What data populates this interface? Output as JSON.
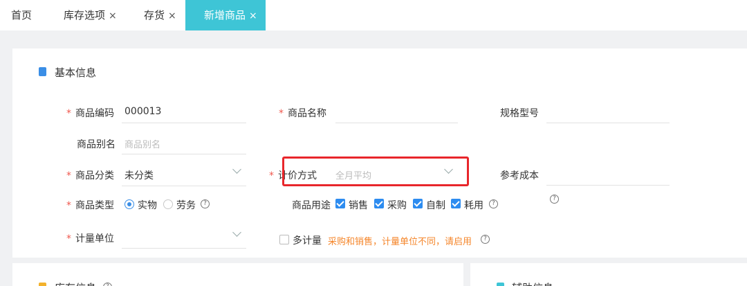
{
  "tabs": [
    {
      "label": "首页",
      "close": ""
    },
    {
      "label": "库存选项",
      "close": "×"
    },
    {
      "label": "存货",
      "close": "×"
    },
    {
      "label": "新增商品",
      "close": "×"
    }
  ],
  "basic": {
    "title": "基本信息",
    "required_mark": "*",
    "code": {
      "label": "商品编码",
      "value": "000013"
    },
    "name": {
      "label": "商品名称",
      "value": ""
    },
    "spec": {
      "label": "规格型号",
      "value": ""
    },
    "alias": {
      "label": "商品别名",
      "placeholder": "商品别名"
    },
    "category": {
      "label": "商品分类",
      "value": "未分类"
    },
    "pricing": {
      "label": "计价方式",
      "placeholder": "全月平均"
    },
    "ref_cost": {
      "label": "参考成本",
      "value": ""
    },
    "type": {
      "label": "商品类型",
      "options": [
        "实物",
        "劳务"
      ],
      "selected": "实物"
    },
    "usage": {
      "label": "商品用途",
      "options": [
        "销售",
        "采购",
        "自制",
        "耗用"
      ],
      "checked": [
        "销售",
        "采购",
        "自制",
        "耗用"
      ]
    },
    "unit": {
      "label": "计量单位",
      "value": ""
    },
    "multi_unit": {
      "label": "多计量",
      "checked": false,
      "hint": "采购和销售，计量单位不同，请启用"
    }
  },
  "stock": {
    "title": "库存信息"
  },
  "aux": {
    "title": "辅助信息"
  },
  "icons": [
    "close-icon",
    "document-icon",
    "chevron-down-icon",
    "help-icon",
    "folder-icon"
  ],
  "colors": {
    "accent": "#3ec5d6",
    "required": "#f0584e",
    "checkbox": "#2d8cf0",
    "warning": "#f5862b",
    "highlight": "#e8262b"
  }
}
